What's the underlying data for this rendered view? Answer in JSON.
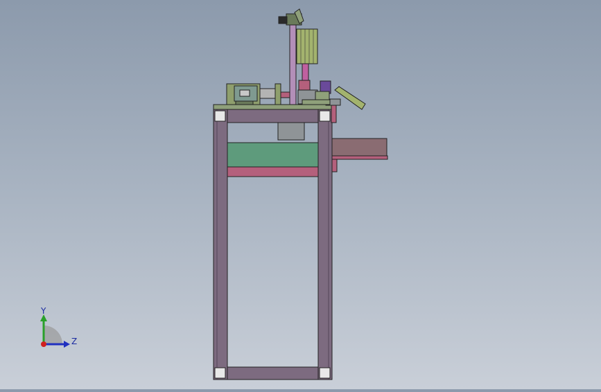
{
  "viewport": {
    "background_top": "#8c9aac",
    "background_bottom": "#c9cfd8"
  },
  "model": {
    "frame_color": "#7d6b80",
    "panel_green": "#5e9b7c",
    "accent_pink": "#b4607c",
    "motor_color": "#8f9f6d",
    "hopper_color": "#a3b36e",
    "tray_color": "#8a6c72"
  },
  "triad": {
    "y_label": "Y",
    "z_label": "Z",
    "y_color": "#2aa02a",
    "z_color": "#2030c0",
    "x_color": "#d02020"
  }
}
